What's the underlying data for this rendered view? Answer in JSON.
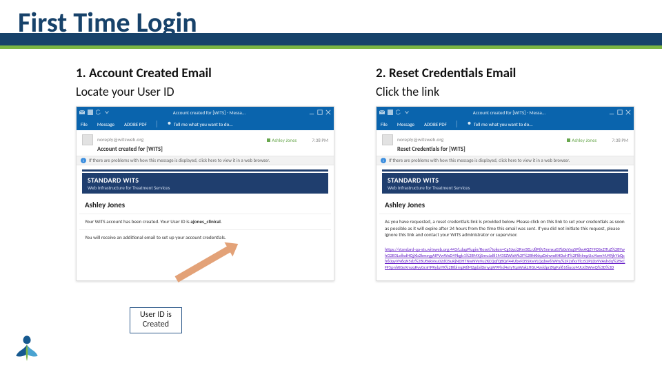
{
  "page": {
    "title": "First Time Login"
  },
  "left": {
    "heading": "1. Account Created Email",
    "sub": "Locate your User ID",
    "callout_l1": "User ID is",
    "callout_l2": "Created"
  },
  "right": {
    "heading": "2. Reset Credentials Email",
    "sub": "Click the link"
  },
  "outlook": {
    "titlebar": "Account created for [WITS] - Messa...",
    "tabs": {
      "file": "File",
      "message": "Message",
      "adobe": "ADOBE PDF",
      "tellme": "Tell me what you want to do..."
    },
    "from": "noreply@witsweb.org",
    "recipient": "Ashley Jones",
    "time": "7:38 PM",
    "infobar": "If there are problems with how this message is displayed, click here to view it in a web browser."
  },
  "brand": {
    "name": "STANDARD WITS",
    "tag": "Web Infrastructure for Treatment Services"
  },
  "email1": {
    "subject": "Account created for [WITS]",
    "greeting": "Ashley Jones",
    "line1a": "Your WITS account has been created. Your User ID is ",
    "userid": "ajones_clinical",
    "line1b": ".",
    "line2": "You will receive an additional email to set up your account credentials."
  },
  "email2": {
    "subject": "Reset Credentials for [WITS]",
    "greeting": "Ashley Jones",
    "body": "As you have requested, a reset credentials link is provided below. Please click on this link to set your credentials as soon as possible as it will expire after 24 hours from the time this email was sent. If you did not initiate this request, please ignore this link and contact your WITS administrator or supervisor.",
    "link": "https://standard-qa-sts.witsweb.org:443/LdapPlugin/Reset?token=Cg5Jyci2Rm5ELrJ8P6V5nmxuG7b0eYaq5P8wAQZY9OSxZITuZ%2BYwhO2B3Le8sdHQjXb2kmxygAIPVwWxD49bgb1%2BMXjSmuJal81M3SZWbWk2F%2BhKkkpDxhwoKHDohT%2F8hlmpUzJ4amMJ49jhYbQch60pyVN6qN5dz%2BUBxkVxu02dOSuRjNDH7NwNVeVu2KCQqfQBQrl44UbvFD5SXwYLQqbw6hWry%2F2sfxsTlczS2PLDx9VAyhdq%2BxCFF5pnhKGeXmzqRyyGraHPRybzYK%2BIblmpR6M2gdalDmyqW9Fhd4etyTqaWakLHGU4zsldprZKgFal616iucoMJUdSWwQ%3D%3D"
  }
}
